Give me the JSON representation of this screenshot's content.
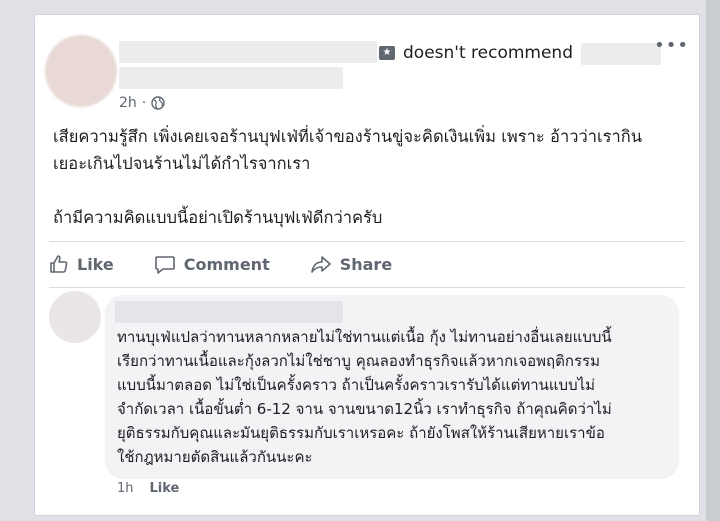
{
  "post": {
    "review_text": "doesn't recommend",
    "time": "2h",
    "separator": "·",
    "body": [
      "เสียความรู้สึก เพิ่งเคยเจอร้านบุฟเฟ่ที่เจ้าของร้านขู่จะคิดเงินเพิ่ม เพราะ อ้าวว่าเรากิน\nเยอะเกินไปจนร้านไม่ได้กำไรจากเรา",
      "ถ้ามีความคิดแบบนี้อย่าเปิดร้านบุฟเฟ่ดีกว่าครับ"
    ],
    "more_icon": "more-horizontal-icon"
  },
  "actions": {
    "like": "Like",
    "comment": "Comment",
    "share": "Share"
  },
  "comment": {
    "text": "ทานบุเฟ่แปลว่าทานหลากหลายไม่ใช่ทานแต่เนื้อ กุ้ง ไม่ทานอย่างอื่นเลยแบบนี้\nเรียกว่าทานเนื้อและกุ้งลวกไม่ใช่ชาบู คุณลองทำธุรกิจแล้วหากเจอพฤติกรรม\nแบบนี้มาตลอด ไม่ใช่เป็นครั้งคราว ถ้าเป็นครั้งคราวเรารับได้แต่ทานแบบไม่\nจำกัดเวลา เนื้อขั้นต่ำ 6-12 จาน จานขนาด12นิ้ว เราทำธุรกิจ ถ้าคุณคิดว่าไม่\nยุติธรรมกับคุณและมันยุติธรรมกับเราเหรอคะ ถ้ายังโพสให้ร้านเสียหายเราข้อ\nใช้กฎหมายตัดสินแล้วกันนะคะ",
    "time": "1h",
    "like": "Like"
  },
  "colors": {
    "background": "#dfe1e6",
    "card": "#ffffff",
    "secondary_text": "#606770",
    "bubble": "#f2f3f5"
  }
}
